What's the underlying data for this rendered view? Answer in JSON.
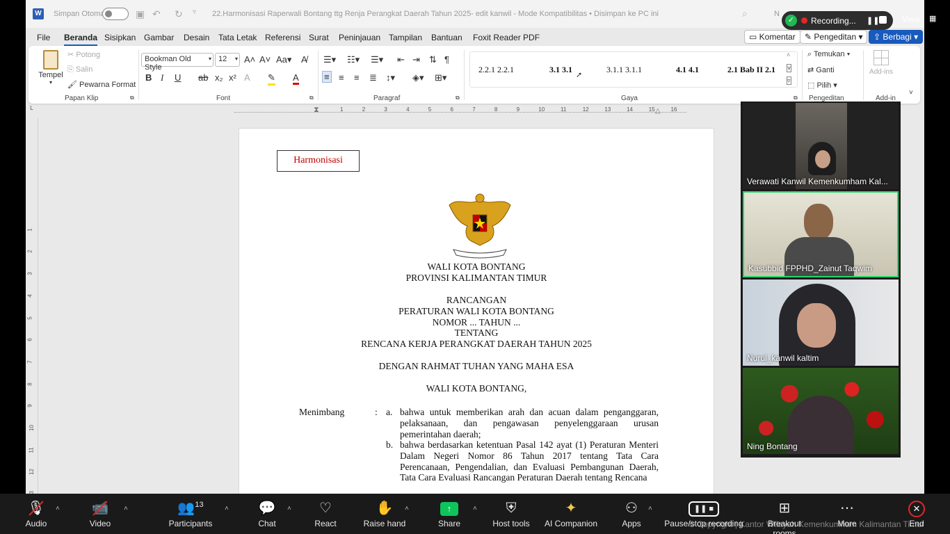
{
  "word": {
    "autosave_label": "Simpan Otomatis",
    "doc_title": "22.Harmonisasi Raperwali Bontang ttg Renja Perangkat Daerah Tahun 2025- edit kanwil  -  Mode Kompatibilitas • Disimpan ke PC ini",
    "user_initial": "N",
    "tabs": [
      "File",
      "Beranda",
      "Sisipkan",
      "Gambar",
      "Desain",
      "Tata Letak",
      "Referensi",
      "Surat",
      "Peninjauan",
      "Tampilan",
      "Bantuan",
      "Foxit Reader PDF"
    ],
    "active_tab": "Beranda",
    "comment_btn": "Komentar",
    "editing_btn": "Pengeditan",
    "share_btn": "Berbagi",
    "ribbon": {
      "paste": "Tempel",
      "cut": "Potong",
      "copy": "Salin",
      "format_painter": "Pewarna Format",
      "clipboard_group": "Papan Klip",
      "font_name": "Bookman Old Style",
      "font_size": "12",
      "font_group": "Font",
      "paragraph_group": "Paragraf",
      "styles": [
        "2.2.1  2.2.1",
        "3.1  3.1",
        "3.1.1  3.1.1",
        "4.1  4.1",
        "2.1  Bab II 2.1"
      ],
      "styles_group": "Gaya",
      "find": "Temukan",
      "replace": "Ganti",
      "select": "Pilih",
      "editing_group": "Pengeditan",
      "addins": "Add-ins",
      "addins_group": "Add-in"
    },
    "ruler_numbers": [
      "1",
      "2",
      "3",
      "4",
      "5",
      "6",
      "7",
      "8",
      "9",
      "10",
      "11",
      "12",
      "13",
      "14",
      "15",
      "16"
    ],
    "document": {
      "harm_label": "Harmonisasi",
      "lines": [
        "WALI KOTA BONTANG",
        "PROVINSI KALIMANTAN TIMUR",
        "RANCANGAN",
        "PERATURAN WALI KOTA BONTANG",
        "NOMOR ... TAHUN ...",
        "TENTANG",
        "RENCANA KERJA PERANGKAT DAERAH TAHUN 2025",
        "DENGAN RAHMAT TUHAN YANG MAHA ESA",
        "WALI KOTA BONTANG,"
      ],
      "menimbang": "Menimbang",
      "colon": ":",
      "item_a_marker": "a.",
      "item_a": "bahwa untuk memberikan arah dan acuan dalam penganggaran, pelaksanaan, dan pengawasan penyelenggaraan urusan pemerintahan daerah;",
      "item_b_marker": "b.",
      "item_b": "bahwa berdasarkan ketentuan Pasal 142 ayat (1) Peraturan Menteri Dalam Negeri Nomor 86 Tahun 2017 tentang Tata Cara Perencanaan, Pengendalian, dan Evaluasi Pembangunan Daerah, Tata Cara Evaluasi Rancangan Peraturan Daerah tentang Rencana"
    }
  },
  "recording": {
    "label": "Recording...",
    "view": "View"
  },
  "participants_video": [
    {
      "name": "Verawati Kanwil Kemenkumham Kal..."
    },
    {
      "name": "Kasubbid FPPHD_Zainut Taqwim"
    },
    {
      "name": "Nurul_kanwil kaltim"
    },
    {
      "name": "Ning Bontang"
    }
  ],
  "zoom_toolbar": {
    "audio": "Audio",
    "video": "Video",
    "participants": "Participants",
    "participants_count": "13",
    "chat": "Chat",
    "react": "React",
    "raise_hand": "Raise hand",
    "share": "Share",
    "host_tools": "Host tools",
    "ai_companion": "AI Companion",
    "apps": "Apps",
    "pause_recording": "Pause/stop recording",
    "breakout": "Breakout rooms",
    "more": "More",
    "end": "End",
    "copyright": "© Copyright | Kantor Wilayah Kemenkumham Kalimantan Timur"
  },
  "colors": {
    "accent": "#185abd",
    "red_text": "#c00000",
    "speaking": "#23d96b",
    "share_green": "#0ec45b"
  }
}
